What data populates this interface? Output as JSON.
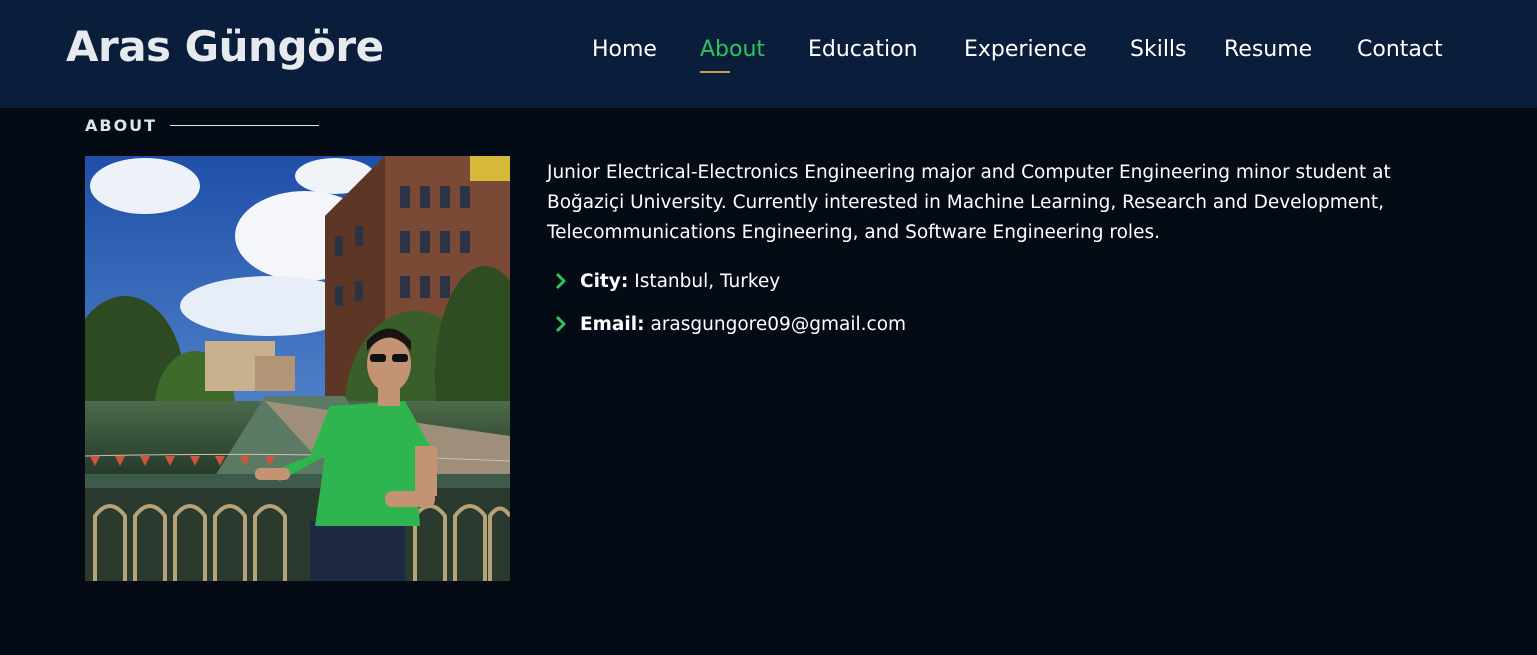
{
  "header": {
    "brand": "Aras Güngöre",
    "nav": [
      {
        "label": "Home",
        "active": false
      },
      {
        "label": "About",
        "active": true
      },
      {
        "label": "Education",
        "active": false
      },
      {
        "label": "Experience",
        "active": false
      },
      {
        "label": "Skills",
        "active": false
      },
      {
        "label": "Resume",
        "active": false
      },
      {
        "label": "Contact",
        "active": false
      }
    ]
  },
  "about": {
    "section_title": "ABOUT",
    "bio": "Junior Electrical-Electronics Engineering major and Computer Engineering minor student at Boğaziçi University. Currently interested in Machine Learning, Research and Development, Telecommunications Engineering, and Software Engineering roles.",
    "details": [
      {
        "label": "City:",
        "value": "Istanbul, Turkey",
        "icon": "chevron-right-icon"
      },
      {
        "label": "Email:",
        "value": "arasgungore09@gmail.com",
        "icon": "chevron-right-icon"
      }
    ]
  },
  "colors": {
    "background": "#040b14",
    "header": "#0a1e3b",
    "accent_green": "#2ec45a",
    "underline_gold": "#c4a24a"
  }
}
